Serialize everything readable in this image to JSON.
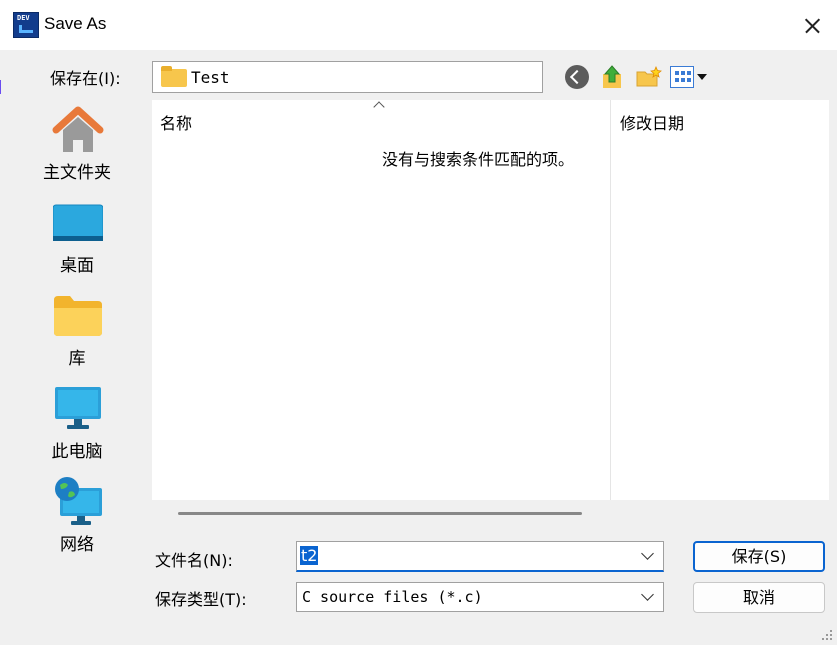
{
  "window": {
    "title": "Save As",
    "app_icon_text": "DEV"
  },
  "toolbar": {
    "save_in_label": "保存在(I):",
    "current_folder": "Test"
  },
  "places": [
    {
      "label": "主文件夹",
      "icon": "home-icon"
    },
    {
      "label": "桌面",
      "icon": "desktop-icon"
    },
    {
      "label": "库",
      "icon": "library-icon"
    },
    {
      "label": "此电脑",
      "icon": "computer-icon"
    },
    {
      "label": "网络",
      "icon": "network-icon"
    }
  ],
  "file_list": {
    "columns": [
      "名称",
      "修改日期"
    ],
    "empty_message": "没有与搜索条件匹配的项。"
  },
  "form": {
    "file_name_label": "文件名(N):",
    "file_name_value": "t2",
    "file_type_label": "保存类型(T):",
    "file_type_value": "C source files (*.c)"
  },
  "buttons": {
    "save": "保存(S)",
    "cancel": "取消"
  },
  "colors": {
    "accent": "#0a64d0",
    "folder": "#f7c64c"
  }
}
